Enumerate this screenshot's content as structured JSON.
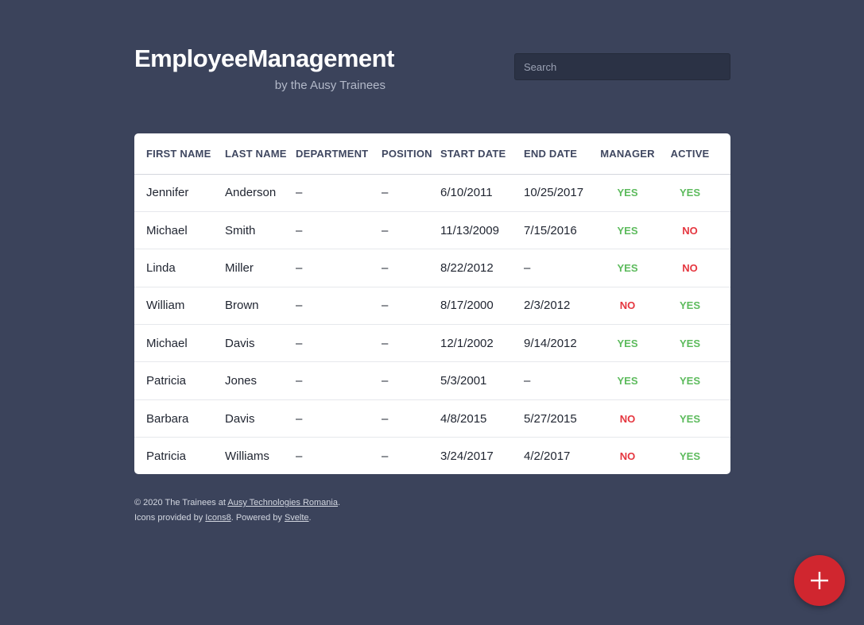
{
  "header": {
    "title": "EmployeeManagement",
    "subtitle": "by the Ausy Trainees"
  },
  "search": {
    "placeholder": "Search",
    "value": ""
  },
  "table": {
    "columns": [
      "FIRST NAME",
      "LAST NAME",
      "DEPARTMENT",
      "POSITION",
      "START DATE",
      "END DATE",
      "MANAGER",
      "ACTIVE"
    ],
    "rows": [
      {
        "first": "Jennifer",
        "last": "Anderson",
        "department": "–",
        "position": "–",
        "start": "6/10/2011",
        "end": "10/25/2017",
        "manager": "YES",
        "active": "YES"
      },
      {
        "first": "Michael",
        "last": "Smith",
        "department": "–",
        "position": "–",
        "start": "11/13/2009",
        "end": "7/15/2016",
        "manager": "YES",
        "active": "NO"
      },
      {
        "first": "Linda",
        "last": "Miller",
        "department": "–",
        "position": "–",
        "start": "8/22/2012",
        "end": "–",
        "manager": "YES",
        "active": "NO"
      },
      {
        "first": "William",
        "last": "Brown",
        "department": "–",
        "position": "–",
        "start": "8/17/2000",
        "end": "2/3/2012",
        "manager": "NO",
        "active": "YES"
      },
      {
        "first": "Michael",
        "last": "Davis",
        "department": "–",
        "position": "–",
        "start": "12/1/2002",
        "end": "9/14/2012",
        "manager": "YES",
        "active": "YES"
      },
      {
        "first": "Patricia",
        "last": "Jones",
        "department": "–",
        "position": "–",
        "start": "5/3/2001",
        "end": "–",
        "manager": "YES",
        "active": "YES"
      },
      {
        "first": "Barbara",
        "last": "Davis",
        "department": "–",
        "position": "–",
        "start": "4/8/2015",
        "end": "5/27/2015",
        "manager": "NO",
        "active": "YES"
      },
      {
        "first": "Patricia",
        "last": "Williams",
        "department": "–",
        "position": "–",
        "start": "3/24/2017",
        "end": "4/2/2017",
        "manager": "NO",
        "active": "YES"
      }
    ]
  },
  "footer": {
    "copyright_prefix": "© 2020 The Trainees at ",
    "company_link": "Ausy Technologies Romania",
    "copyright_suffix": ".",
    "icons_prefix": "Icons provided by ",
    "icons_link": "Icons8",
    "powered_text": ". Powered by ",
    "powered_link": "Svelte",
    "end": "."
  },
  "fab": {
    "icon": "plus-icon"
  },
  "colors": {
    "background": "#3b435b",
    "yes": "#5dbb5d",
    "no": "#e5363f",
    "fab": "#d0262f"
  }
}
